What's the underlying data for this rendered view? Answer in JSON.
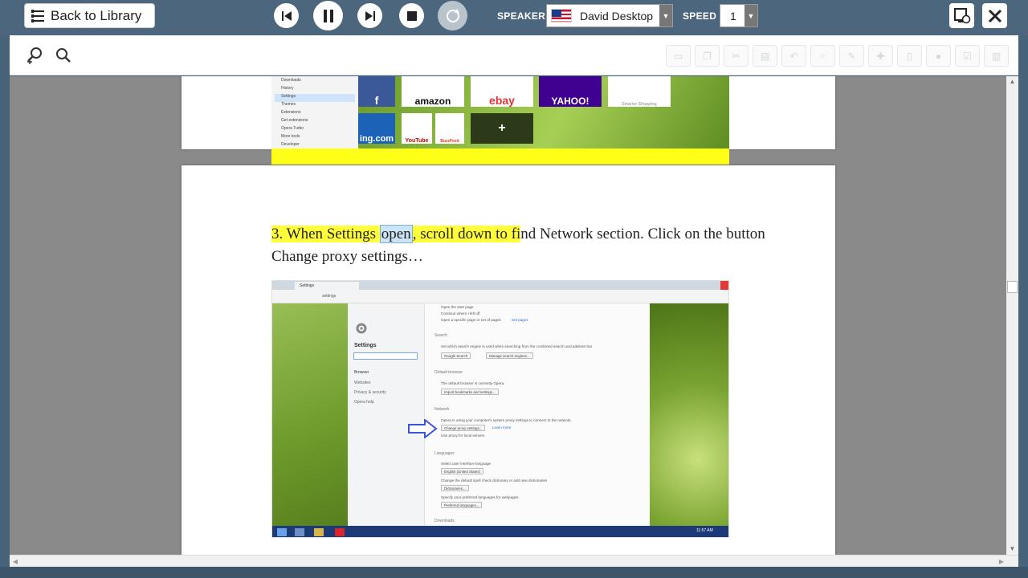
{
  "player": {
    "back_label": "Back to Library",
    "speaker_label": "SPEAKER",
    "voice": "David Desktop",
    "speed_label": "SPEED",
    "speed_value": "1"
  },
  "page_top": {
    "menu_items": [
      "Downloads",
      "History",
      "Settings",
      "Themes",
      "Extensions",
      "Get extensions",
      "Opera Turbo",
      "More tools",
      "Developer"
    ],
    "menu_selected": "Settings",
    "tiles": [
      "amazon",
      "ebay",
      "YAHOO!",
      "YouTube",
      "BuzzFeed"
    ]
  },
  "page_main": {
    "step_highlighted": "3. When Settings ",
    "step_word": "open",
    "step_hl_tail": ", scroll down to fi",
    "step_rest": "nd Network section. Click on the button Change proxy settings…",
    "shot": {
      "tab_label": "Settings",
      "address": "settings",
      "side_title": "Settings",
      "side_nav": [
        "Browser",
        "Websites",
        "Privacy & security",
        "Opera help"
      ],
      "rows": [
        {
          "kind": "r",
          "text": "Open the start page"
        },
        {
          "kind": "r",
          "text": "Continue where I left off"
        },
        {
          "kind": "r",
          "text": "Open a specific page or set of pages"
        },
        {
          "kind": "h",
          "text": "Search"
        },
        {
          "kind": "r",
          "text": "Set which search engine is used when searching from the combined search and address bar"
        },
        {
          "kind": "b",
          "text": "Google Search"
        },
        {
          "kind": "h",
          "text": "Default browser"
        },
        {
          "kind": "r",
          "text": "The default browser is currently Opera."
        },
        {
          "kind": "b",
          "text": "Import bookmarks and settings..."
        },
        {
          "kind": "h",
          "text": "Network"
        },
        {
          "kind": "r",
          "text": "Opera is using your computer's system proxy settings to connect to the network."
        },
        {
          "kind": "b",
          "text": "Change proxy settings..."
        },
        {
          "kind": "r",
          "text": "Use proxy for local servers"
        },
        {
          "kind": "h",
          "text": "Languages"
        },
        {
          "kind": "r",
          "text": "Select user interface language"
        },
        {
          "kind": "b",
          "text": "English (United States)"
        },
        {
          "kind": "r",
          "text": "Change the default spell check dictionary or add new dictionaries"
        },
        {
          "kind": "b",
          "text": "Dictionaries..."
        },
        {
          "kind": "r",
          "text": "Specify your preferred languages for webpages"
        },
        {
          "kind": "b",
          "text": "Preferred languages..."
        },
        {
          "kind": "h",
          "text": "Downloads"
        }
      ],
      "learn_more": "Learn more",
      "set_pages": "Set pages",
      "manage_engines": "Manage search engines...",
      "clock": "11:57 AM"
    }
  },
  "colors": {
    "highlight": "#ffff3a",
    "chrome": "#4c667d",
    "word_box": "#cde3f6"
  }
}
